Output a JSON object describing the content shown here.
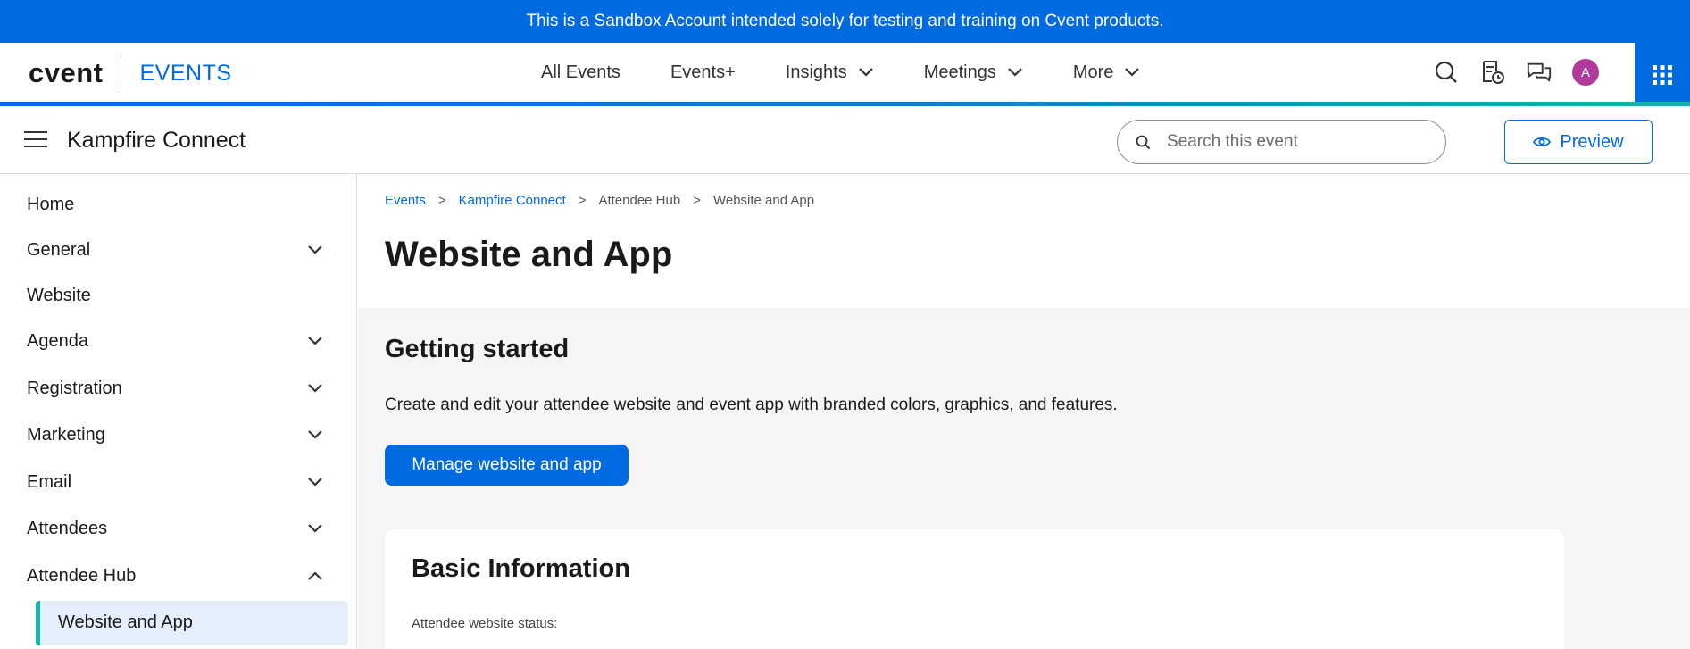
{
  "banner": {
    "text": "This is a Sandbox Account intended solely for testing and training on Cvent products."
  },
  "header": {
    "brand": "cvent",
    "product": "EVENTS",
    "nav": [
      {
        "label": "All Events",
        "has_dropdown": false
      },
      {
        "label": "Events+",
        "has_dropdown": false
      },
      {
        "label": "Insights",
        "has_dropdown": true
      },
      {
        "label": "Meetings",
        "has_dropdown": true
      },
      {
        "label": "More",
        "has_dropdown": true
      }
    ],
    "icons": [
      "search-icon",
      "task-history-icon",
      "chat-icon"
    ],
    "avatar_initial": "A",
    "avatar_color": "#b23a9a"
  },
  "event": {
    "title": "Kampfire Connect",
    "search_placeholder": "Search this event",
    "preview_label": "Preview"
  },
  "sidebar": {
    "items": [
      {
        "label": "Home",
        "expandable": false
      },
      {
        "label": "General",
        "expandable": true,
        "expanded": false
      },
      {
        "label": "Website",
        "expandable": false
      },
      {
        "label": "Agenda",
        "expandable": true,
        "expanded": false
      },
      {
        "label": "Registration",
        "expandable": true,
        "expanded": false
      },
      {
        "label": "Marketing",
        "expandable": true,
        "expanded": false
      },
      {
        "label": "Email",
        "expandable": true,
        "expanded": false
      },
      {
        "label": "Attendees",
        "expandable": true,
        "expanded": false
      },
      {
        "label": "Attendee Hub",
        "expandable": true,
        "expanded": true
      }
    ],
    "active_subitem": "Website and App"
  },
  "main": {
    "breadcrumb": [
      "Events",
      "Kampfire Connect",
      "Attendee Hub",
      "Website and App"
    ],
    "page_title": "Website and App",
    "getting_started": {
      "title": "Getting started",
      "description": "Create and edit your attendee website and event app with branded colors, graphics, and features.",
      "button": "Manage website and app"
    },
    "basic_info": {
      "title": "Basic Information",
      "status_label": "Attendee website status:"
    }
  },
  "colors": {
    "primary": "#006ae1",
    "accent_teal": "#14b8a6",
    "active_bg": "#e5effb",
    "content_bg": "#f5f5f5"
  }
}
